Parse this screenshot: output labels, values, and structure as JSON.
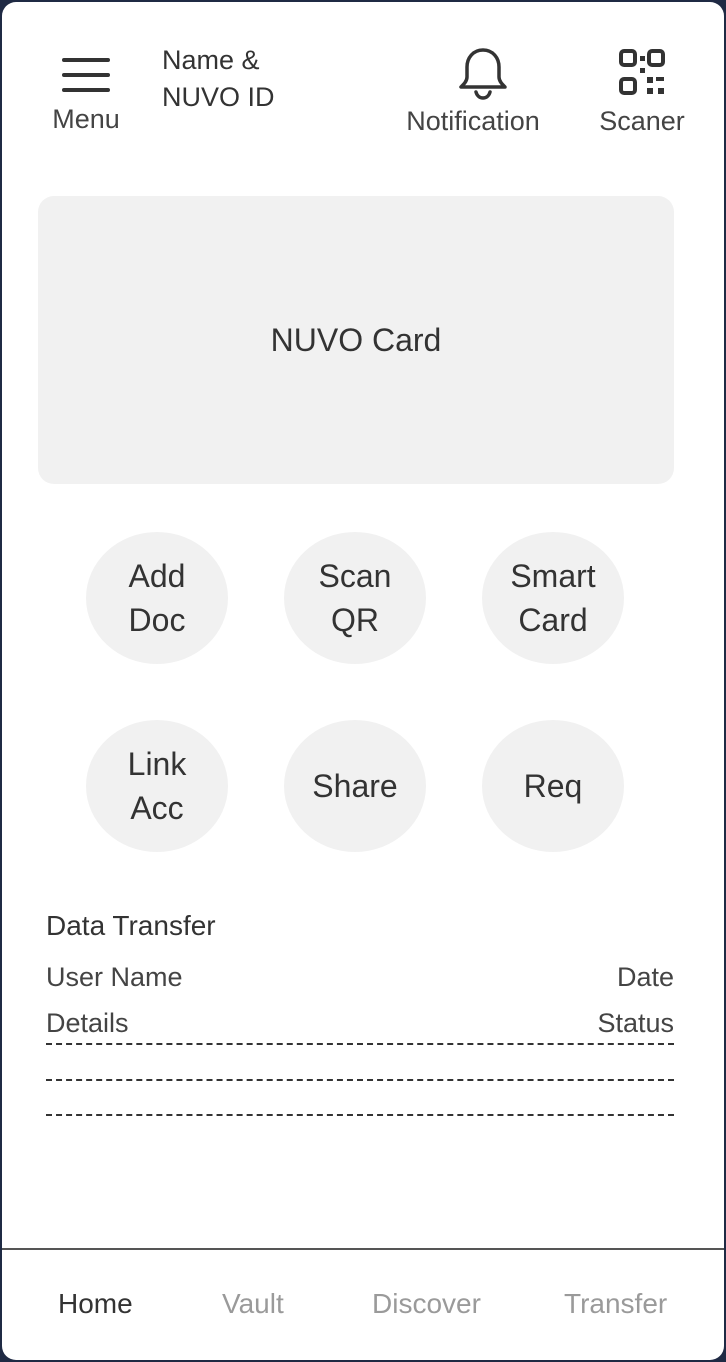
{
  "header": {
    "menu_label": "Menu",
    "menu_icon": "hamburger-icon",
    "profile_name_line1": "Name &",
    "profile_name_line2": "NUVO ID",
    "notification_label": "Notification",
    "notification_icon": "bell-icon",
    "scanner_label": "Scaner",
    "scanner_icon": "qr-code-icon"
  },
  "card": {
    "label": "NUVO Card"
  },
  "actions": [
    {
      "line1": "Add",
      "line2": "Doc"
    },
    {
      "line1": "Scan",
      "line2": "QR"
    },
    {
      "line1": "Smart",
      "line2": "Card"
    },
    {
      "line1": "Link",
      "line2": "Acc"
    },
    {
      "line1": "Share",
      "line2": ""
    },
    {
      "line1": "Req",
      "line2": ""
    }
  ],
  "data_transfer": {
    "title": "Data Transfer",
    "user_name_label": "User Name",
    "date_label": "Date",
    "details_label": "Details",
    "status_label": "Status"
  },
  "bottom_nav": {
    "items": [
      {
        "label": "Home",
        "active": true
      },
      {
        "label": "Vault",
        "active": false
      },
      {
        "label": "Discover",
        "active": false
      },
      {
        "label": "Transfer",
        "active": false
      }
    ]
  },
  "colors": {
    "frame_bg": "#1f2a44",
    "surface": "#ffffff",
    "tile_bg": "#f1f1f1",
    "text_primary": "#333333",
    "text_inactive": "#9a9a9a"
  }
}
